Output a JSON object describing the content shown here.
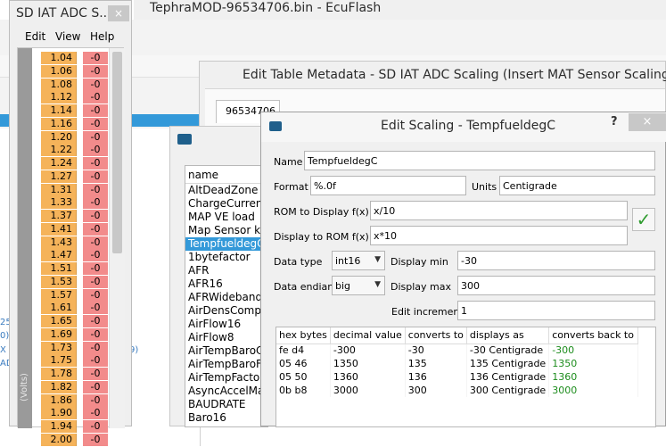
{
  "main_window": {
    "title": "TephraMOD-96534706.bin - EcuFlash",
    "bg_fragments": [
      "25",
      "0)",
      "X",
      "AD",
      "9)"
    ]
  },
  "metadata_window": {
    "title": "Edit Table Metadata - SD IAT ADC Scaling (Insert MAT Sensor Scaling)",
    "tab_label": "96534706"
  },
  "scalings_list": {
    "header": "name",
    "items": [
      {
        "label": "AltDeadZone",
        "selected": false
      },
      {
        "label": "ChargeCurrent",
        "selected": false
      },
      {
        "label": "MAP VE load",
        "selected": false
      },
      {
        "label": "Map Sensor kP",
        "selected": false
      },
      {
        "label": "TempfueldegC",
        "selected": true
      },
      {
        "label": "1bytefactor",
        "selected": false
      },
      {
        "label": "AFR",
        "selected": false
      },
      {
        "label": "AFR16",
        "selected": false
      },
      {
        "label": "AFRWideband",
        "selected": false
      },
      {
        "label": "AirDensComp",
        "selected": false
      },
      {
        "label": "AirFlow16",
        "selected": false
      },
      {
        "label": "AirFlow8",
        "selected": false
      },
      {
        "label": "AirTempBaroC",
        "selected": false
      },
      {
        "label": "AirTempBaroF",
        "selected": false
      },
      {
        "label": "AirTempFactor",
        "selected": false
      },
      {
        "label": "AsyncAccelMa",
        "selected": false
      },
      {
        "label": "BAUDRATE",
        "selected": false
      },
      {
        "label": "Baro16",
        "selected": false
      }
    ]
  },
  "edit_scaling": {
    "title": "Edit Scaling - TempfueldegC",
    "help": "?",
    "close": "×",
    "name_label": "Name",
    "name_value": "TempfueldegC",
    "format_label": "Format",
    "format_value": "%.0f",
    "units_label": "Units",
    "units_value": "Centigrade",
    "rom_to_display_label": "ROM to Display f(x)=",
    "rom_to_display_value": "x/10",
    "display_to_rom_label": "Display to ROM f(x)=",
    "display_to_rom_value": "x*10",
    "data_type_label": "Data type",
    "data_type_value": "int16",
    "display_min_label": "Display min",
    "display_min_value": "-30",
    "data_endian_label": "Data endian",
    "data_endian_value": "big",
    "display_max_label": "Display max",
    "display_max_value": "300",
    "edit_increment_label": "Edit increment",
    "edit_increment_value": "1",
    "columns": [
      "hex bytes",
      "decimal value",
      "converts to",
      "displays as",
      "converts back to"
    ],
    "rows": [
      [
        "fe d4",
        "-300",
        "-30",
        "-30 Centigrade",
        "-300"
      ],
      [
        "05 46",
        "1350",
        "135",
        "135 Centigrade",
        "1350"
      ],
      [
        "05 50",
        "1360",
        "136",
        "136 Centigrade",
        "1360"
      ],
      [
        "0b b8",
        "3000",
        "300",
        "300 Centigrade",
        "3000"
      ]
    ],
    "colors": {
      "ok_green": "#1c8c1c",
      "check_green": "#2e9b2e"
    }
  },
  "iat_window": {
    "title": "SD IAT ADC S...",
    "close": "×",
    "menu": [
      "Edit",
      "View",
      "Help"
    ],
    "axis_label": "(Volts)",
    "rows": [
      {
        "volts": "1.04",
        "value": "-0"
      },
      {
        "volts": "1.06",
        "value": "-0"
      },
      {
        "volts": "1.08",
        "value": "-0"
      },
      {
        "volts": "1.12",
        "value": "-0"
      },
      {
        "volts": "1.14",
        "value": "-0"
      },
      {
        "volts": "1.16",
        "value": "-0"
      },
      {
        "volts": "1.20",
        "value": "-0"
      },
      {
        "volts": "1.22",
        "value": "-0"
      },
      {
        "volts": "1.24",
        "value": "-0"
      },
      {
        "volts": "1.27",
        "value": "-0"
      },
      {
        "volts": "1.31",
        "value": "-0"
      },
      {
        "volts": "1.33",
        "value": "-0"
      },
      {
        "volts": "1.37",
        "value": "-0"
      },
      {
        "volts": "1.41",
        "value": "-0"
      },
      {
        "volts": "1.43",
        "value": "-0"
      },
      {
        "volts": "1.47",
        "value": "-0"
      },
      {
        "volts": "1.51",
        "value": "-0"
      },
      {
        "volts": "1.53",
        "value": "-0"
      },
      {
        "volts": "1.57",
        "value": "-0"
      },
      {
        "volts": "1.61",
        "value": "-0"
      },
      {
        "volts": "1.65",
        "value": "-0"
      },
      {
        "volts": "1.69",
        "value": "-0"
      },
      {
        "volts": "1.73",
        "value": "-0"
      },
      {
        "volts": "1.75",
        "value": "-0"
      },
      {
        "volts": "1.78",
        "value": "-0"
      },
      {
        "volts": "1.82",
        "value": "-0"
      },
      {
        "volts": "1.86",
        "value": "-0"
      },
      {
        "volts": "1.90",
        "value": "-0"
      },
      {
        "volts": "1.94",
        "value": "-0"
      },
      {
        "volts": "2.00",
        "value": "-0"
      }
    ]
  }
}
